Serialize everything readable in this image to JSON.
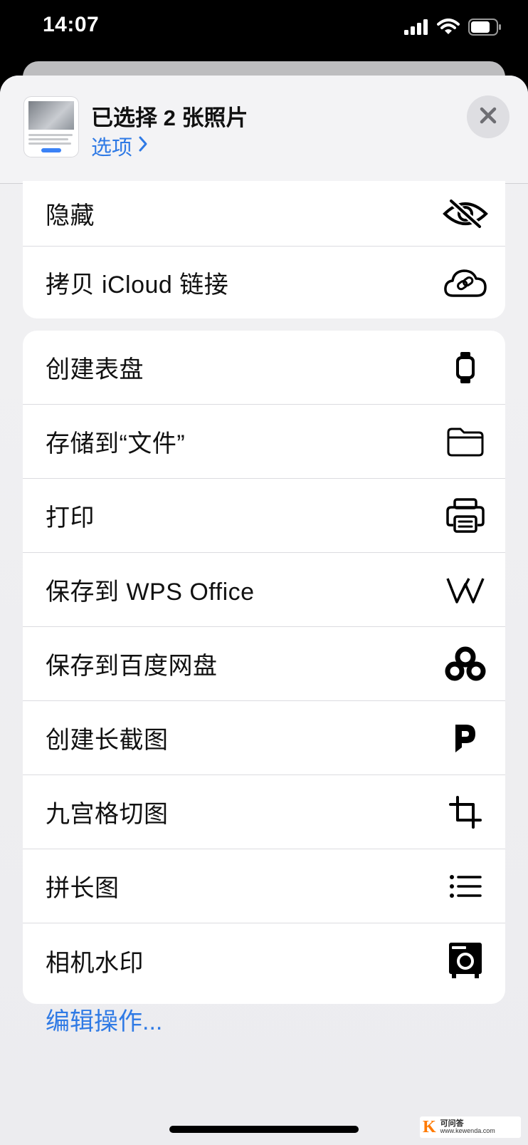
{
  "status_bar": {
    "time": "14:07"
  },
  "header": {
    "title": "已选择 2 张照片",
    "options_label": "选项",
    "close_icon": "close-icon"
  },
  "group1": [
    {
      "label": "隐藏",
      "icon": "eye-slash-icon"
    },
    {
      "label": "拷贝 iCloud 链接",
      "icon": "cloud-link-icon"
    }
  ],
  "group2": [
    {
      "label": "创建表盘",
      "icon": "watch-icon"
    },
    {
      "label": "存储到“文件”",
      "icon": "folder-icon"
    },
    {
      "label": "打印",
      "icon": "printer-icon"
    },
    {
      "label": "保存到 WPS Office",
      "icon": "wps-icon"
    },
    {
      "label": "保存到百度网盘",
      "icon": "baidu-netdisk-icon"
    },
    {
      "label": "创建长截图",
      "icon": "picsew-icon"
    },
    {
      "label": "九宫格切图",
      "icon": "crop-icon"
    },
    {
      "label": "拼长图",
      "icon": "list-icon"
    },
    {
      "label": "相机水印",
      "icon": "camera-watermark-icon"
    }
  ],
  "edit_actions_label": "编辑操作...",
  "watermark": {
    "letter": "K",
    "name": "可问答",
    "url": "www.kewenda.com"
  },
  "colors": {
    "accent": "#2f7ae5",
    "row_bg": "#ffffff",
    "sheet_bg": "#efeff2"
  }
}
